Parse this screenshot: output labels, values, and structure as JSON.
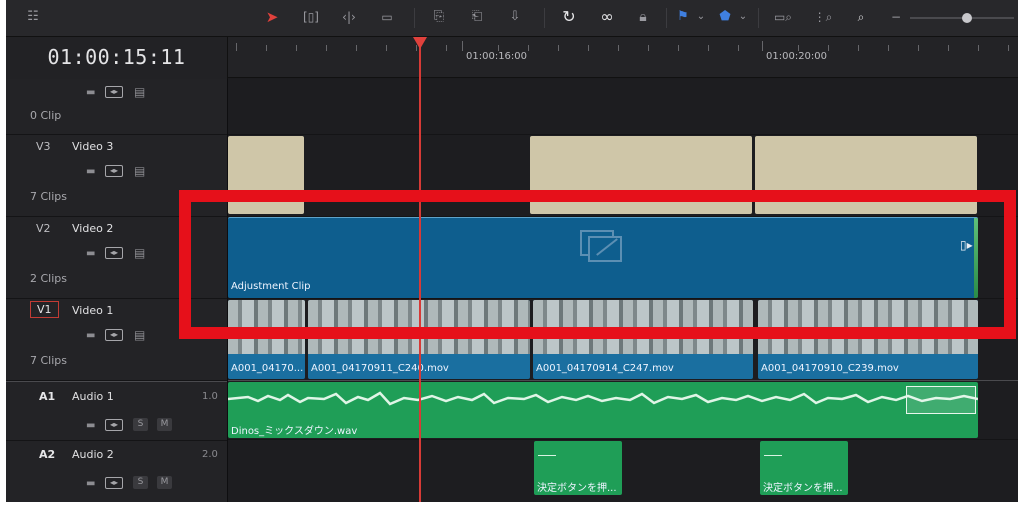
{
  "timeline": {
    "timecode": "01:00:15:11",
    "ruler": {
      "marks": [
        "01:00:16:00",
        "01:00:20:00"
      ]
    },
    "zoom_level_pct": 92
  },
  "icons": {
    "selection_tool": "cursor-icon",
    "trim": "trim-icon",
    "dynamic_trim": "dynamic-trim-icon",
    "blade": "blade-icon",
    "insert": "insert-icon",
    "overwrite": "overwrite-icon",
    "replace": "replace-icon",
    "snapping": "snap-icon",
    "linked": "link-icon",
    "lock": "lock-icon",
    "flag": "flag-icon",
    "marker": "marker-icon",
    "zoom_full": "zoom-full-icon",
    "zoom_detail": "zoom-detail-icon",
    "zoom_custom": "zoom-custom-icon"
  },
  "tracks": {
    "empty": {
      "clips_label": "0 Clip"
    },
    "v3": {
      "id": "V3",
      "name": "Video 3",
      "clips_label": "7 Clips"
    },
    "v2": {
      "id": "V2",
      "name": "Video 2",
      "clips_label": "2 Clips"
    },
    "v1": {
      "id": "V1",
      "name": "Video 1",
      "clips_label": "7 Clips"
    },
    "a1": {
      "id": "A1",
      "name": "Audio 1",
      "level": "1.0",
      "solo": "S",
      "mute": "M"
    },
    "a2": {
      "id": "A2",
      "name": "Audio 2",
      "level": "2.0",
      "solo": "S",
      "mute": "M"
    }
  },
  "clips": {
    "adjustment": "Adjustment Clip",
    "v1": [
      "A001_04170...",
      "A001_04170911_C240.mov",
      "A001_04170914_C247.mov",
      "A001_04170910_C239.mov"
    ],
    "a1": "Dinos_ミックスダウン.wav",
    "a2": [
      "決定ボタンを押...",
      "決定ボタンを押..."
    ]
  },
  "colors": {
    "video_clip": "#1a6fa0",
    "adjustment_clip": "#0e5e8e",
    "title_clip": "#cfc6a8",
    "audio_clip": "#1f9e57",
    "highlight": "#e6101a",
    "playhead": "#d73a36"
  }
}
